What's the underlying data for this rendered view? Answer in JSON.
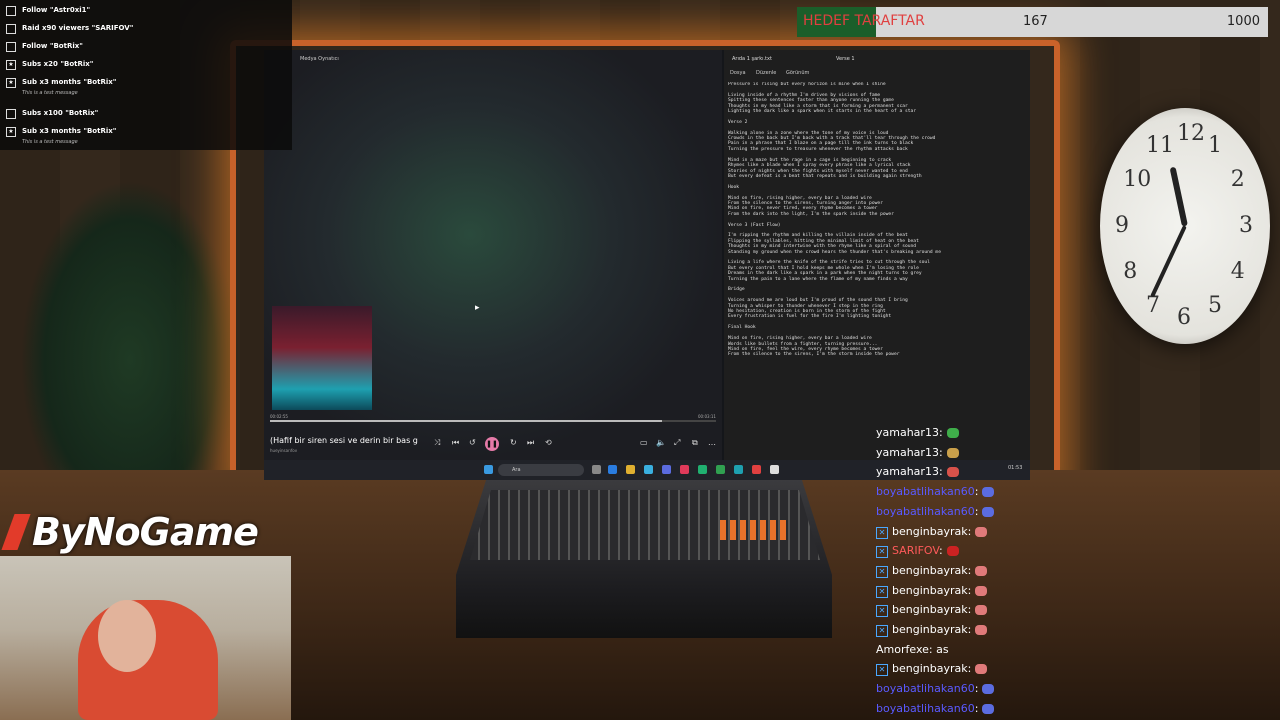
{
  "alerts": [
    {
      "icon": "checkbox-icon",
      "text": "Follow \"Astr0xi1\"",
      "sub": ""
    },
    {
      "icon": "checkbox-icon",
      "text": "Raid x90 viewers \"SARIFOV\"",
      "sub": ""
    },
    {
      "icon": "checkbox-icon",
      "text": "Follow \"BotRix\"",
      "sub": ""
    },
    {
      "icon": "star-icon",
      "text": "Subs x20 \"BotRix\"",
      "sub": ""
    },
    {
      "icon": "star-icon",
      "text": "Sub x3 months \"BotRix\"",
      "sub": "This is a test message"
    },
    {
      "icon": "checkbox-icon",
      "text": "Subs x100 \"BotRix\"",
      "sub": ""
    },
    {
      "icon": "star-icon",
      "text": "Sub x3 months \"BotRix\"",
      "sub": "This is a test message"
    }
  ],
  "goal": {
    "label": "HEDEF TARAFTAR",
    "current": "167",
    "target": "1000",
    "progress": 0.167
  },
  "media_player": {
    "window_title": "Medya Oynatıcı",
    "song_title": "(Hafif bir siren sesi ve derin bir bas g",
    "artist": "hueyinsarıfov",
    "elapsed": "00:02:55",
    "total": "00:03:11",
    "progress": 0.88
  },
  "notepad": {
    "tab1": "Arıda 1 şarkı.txt",
    "tab2": "Verse 1",
    "menu": [
      "Dosya",
      "Düzenle",
      "Görünüm"
    ],
    "lyrics": "Pressure is rising but every horizon is mine when I shine\n\nLiving inside of a rhythm I'm driven by visions of fame\nSpitting these sentences faster than anyone running the game\nThoughts in my head like a storm that is forming a permanent scar\nLighting the dark like a spark when it starts in the heart of a star\n\nVerse 2\n\nWalking alone in a zone where the tone of my voice is loud\nCrowds in the back but I'm back with a track that'll tear through the crowd\nPain in a phrase that I blaze on a page till the ink turns to black\nTurning the pressure to treasure whenever the rhythm attacks back\n\nMind in a maze but the rage in a cage is beginning to crack\nRhymes like a blade when I spray every phrase like a lyrical stack\nStories of nights when the fights with myself never wanted to end\nBut every defeat is a beat that repeats and is building again strength\n\nHook\n\nMind on fire, rising higher, every bar a loaded wire\nFrom the silence to the sirens, turning anger into power\nMind on fire, never tired, every rhyme becomes a tower\nFrom the dark into the light, I'm the spark inside the power\n\nVerse 3 (Fast Flow)\n\nI'm ripping the rhythm and killing the villain inside of the beat\nFlipping the syllables, hitting the minimal limit of heat on the beat\nThoughts in my mind intertwine with the rhyme like a spiral of sound\nStanding my ground when the crowd hears the thunder that's breaking around me\n\nLiving a life where the knife of the strife tries to cut through the soul\nBut every control that I hold keeps me whole when I'm losing the role\nDreams in the dark like a spark in a park when the night turns to grey\nTurning the pain to a lane where the flame of my name finds a way\n\nBridge\n\nVoices around me are loud but I'm proud of the sound that I bring\nTurning a whisper to thunder whenever I step in the ring\nNo hesitation, creation is born in the storm of the fight\nEvery frustration is fuel for the fire I'm lighting tonight\n\nFinal Hook\n\nMind on fire, rising higher, every bar a loaded wire\nWords like bullets from a fighter, turning pressure...\nMind on fire, feel the wire, every rhyme becomes a tower\nFrom the silence to the sirens, I'm the storm inside the power"
  },
  "taskbar": {
    "search": "Ara",
    "clock": "01:53"
  },
  "logo": "ByNoGame",
  "chat": [
    {
      "user": "yamahar13",
      "text": ":",
      "color": "#ffffff",
      "badge": false,
      "emote": "#3fae4a"
    },
    {
      "user": "yamahar13",
      "text": ":",
      "color": "#ffffff",
      "badge": false,
      "emote": "#caa04a"
    },
    {
      "user": "yamahar13",
      "text": ":",
      "color": "#ffffff",
      "badge": false,
      "emote": "#d9524a"
    },
    {
      "user": "boyabatlihakan60",
      "text": ":",
      "color": "#5a5aff",
      "badge": false,
      "emote": "#5b6ce0"
    },
    {
      "user": "boyabatlihakan60",
      "text": ":",
      "color": "#5a5aff",
      "badge": false,
      "emote": "#5b6ce0"
    },
    {
      "user": "benginbayrak",
      "text": ":",
      "color": "#ffffff",
      "badge": true,
      "emote": "#e07a7a"
    },
    {
      "user": "SARIFOV",
      "text": ":",
      "color": "#ff5a5a",
      "badge": true,
      "emote": "#cc2222"
    },
    {
      "user": "benginbayrak",
      "text": ":",
      "color": "#ffffff",
      "badge": true,
      "emote": "#e07a7a"
    },
    {
      "user": "benginbayrak",
      "text": ":",
      "color": "#ffffff",
      "badge": true,
      "emote": "#e07a7a"
    },
    {
      "user": "benginbayrak",
      "text": ":",
      "color": "#ffffff",
      "badge": true,
      "emote": "#e07a7a"
    },
    {
      "user": "benginbayrak",
      "text": ":",
      "color": "#ffffff",
      "badge": true,
      "emote": "#e07a7a"
    },
    {
      "user": "Amorfexe",
      "text": ": as",
      "color": "#ffffff",
      "badge": false,
      "emote": ""
    },
    {
      "user": "benginbayrak",
      "text": ":",
      "color": "#ffffff",
      "badge": true,
      "emote": "#e07a7a"
    },
    {
      "user": "boyabatlihakan60",
      "text": ":",
      "color": "#5a5aff",
      "badge": false,
      "emote": "#5b6ce0"
    },
    {
      "user": "boyabatlihakan60",
      "text": ":",
      "color": "#5a5aff",
      "badge": false,
      "emote": "#5b6ce0"
    }
  ],
  "clock_numbers": [
    "12",
    "1",
    "2",
    "3",
    "4",
    "5",
    "6",
    "7",
    "8",
    "9",
    "10",
    "11"
  ]
}
